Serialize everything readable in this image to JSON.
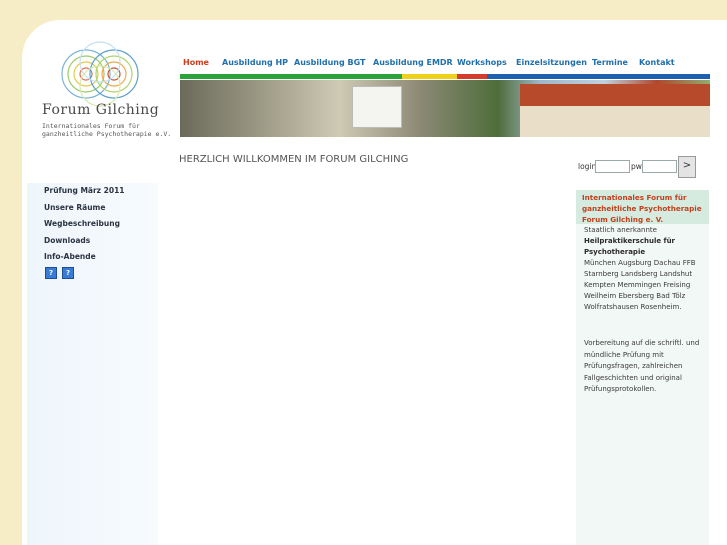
{
  "logo": {
    "title": "Forum Gilching",
    "subtitle": "Internationales Forum für ganzheitliche Psychotherapie e.V."
  },
  "nav": [
    {
      "label": "Home"
    },
    {
      "label": "Ausbildung HP"
    },
    {
      "label": "Ausbildung BGT"
    },
    {
      "label": "Ausbildung EMDR"
    },
    {
      "label": "Workshops"
    },
    {
      "label": "Einzelsitzungen"
    },
    {
      "label": "Termine"
    },
    {
      "label": "Kontakt"
    }
  ],
  "colors": {
    "nav_text": "#1f6fad",
    "nav_active": "#d03a1a",
    "bar_green": "#2aa33a",
    "bar_blue": "#1d5fb0",
    "bar_yellow": "#f0d11a",
    "bar_red": "#d63a2b",
    "page_bg": "#f6ecc6"
  },
  "welcome": "HERZLICH WILLKOMMEN IM FORUM GILCHING",
  "login": {
    "login_label": "login",
    "pw_label": "pw",
    "submit": ">"
  },
  "sidebar": [
    {
      "label": "Prüfung März 2011"
    },
    {
      "label": "Unsere Räume"
    },
    {
      "label": "Wegbeschreibung"
    },
    {
      "label": "Downloads"
    },
    {
      "label": "Info-Abende"
    }
  ],
  "sidebar_icons": [
    "?",
    "?"
  ],
  "info": {
    "heading": "Internationales Forum für ganzheitliche Psychotherapie Forum Gilching e. V.",
    "line1": "Staatlich anerkannte",
    "bold": "Heilpraktikerschule für Psychotherapie",
    "cities": "München Augsburg Dachau FFB Starnberg Landsberg Landshut Kempten Memmingen Freising Weilheim Ebersberg Bad Tölz Wolfratshausen Rosenheim.",
    "prep": "Vorbereitung auf die schriftl. und mündliche Prüfung mit Prüfungsfragen, zahlreichen Fallgeschichten und original Prüfungsprotokollen."
  }
}
